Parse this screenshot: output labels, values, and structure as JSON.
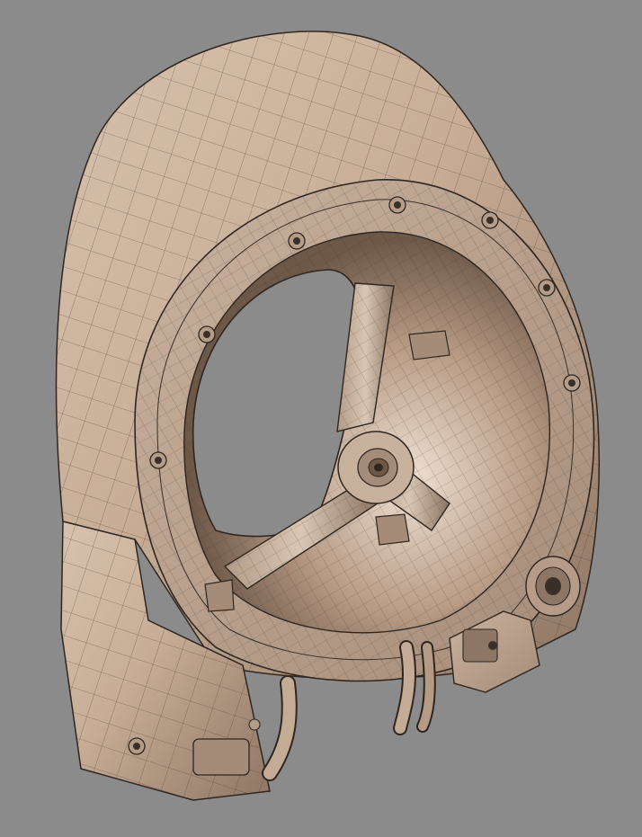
{
  "scene": {
    "subject": "",
    "background_color": "#8b8b8b",
    "surface_color": "#c9b09a",
    "wire_color": "#3a2f28",
    "shadow_color": "#6e5a4b"
  }
}
